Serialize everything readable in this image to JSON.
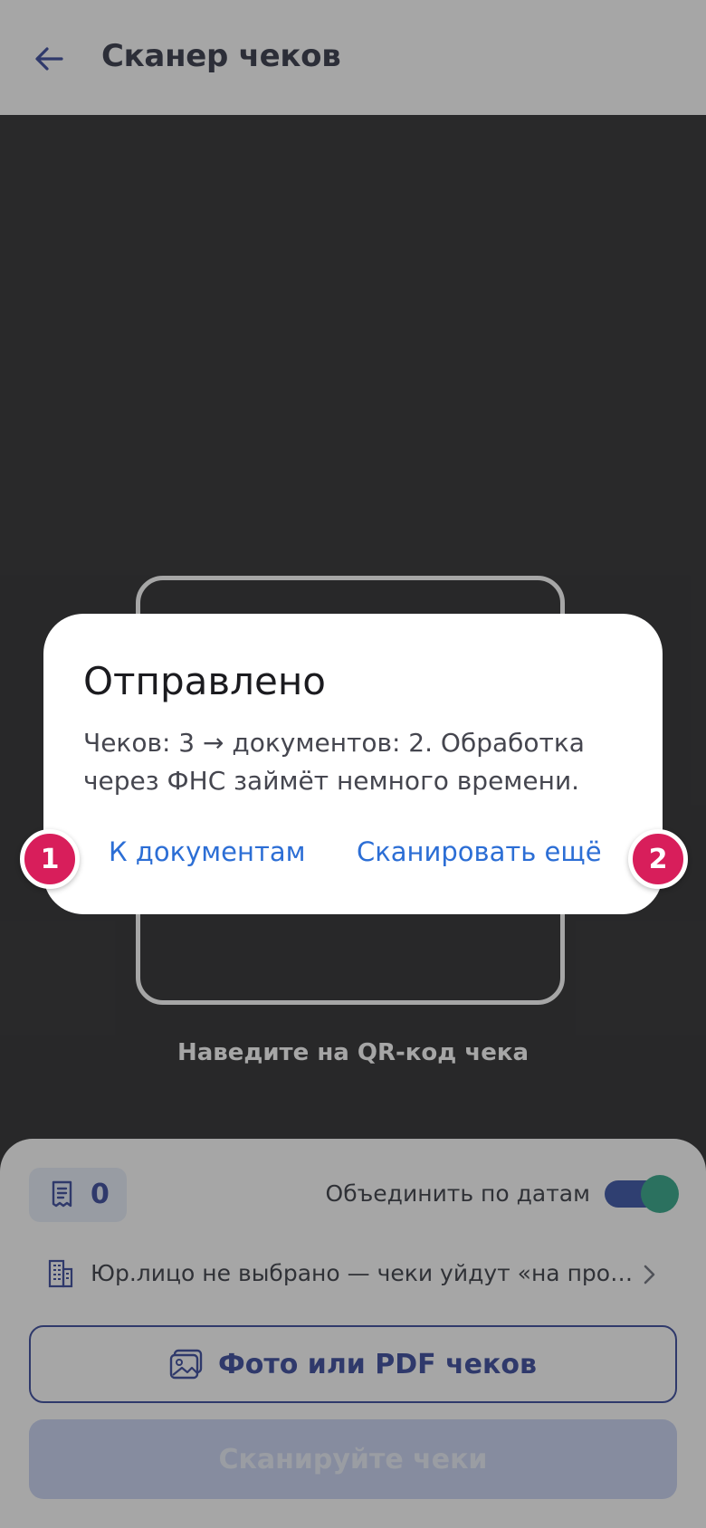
{
  "header": {
    "title": "Сканер чеков",
    "back_icon": "arrow-left-icon"
  },
  "camera": {
    "hint": "Наведите на QR-код чека"
  },
  "sheet": {
    "receipt_count": "0",
    "merge_label": "Объединить по датам",
    "merge_enabled": true,
    "entity_text": "Юр.лицо не выбрано — чеки уйдут «на про…",
    "photo_button": "Фото или PDF чеков",
    "scan_button": "Сканируйте чеки"
  },
  "dialog": {
    "title": "Отправлено",
    "body": "Чеков: 3 → документов: 2. Обработка через ФНС займёт немного времени.",
    "btn_docs": "К документам",
    "btn_more": "Сканировать ещё"
  },
  "badges": [
    "1",
    "2"
  ],
  "colors": {
    "accent": "#1b2f8f",
    "link": "#2c6ed5",
    "badge": "#d81e5b",
    "toggle_knob": "#159a77"
  }
}
